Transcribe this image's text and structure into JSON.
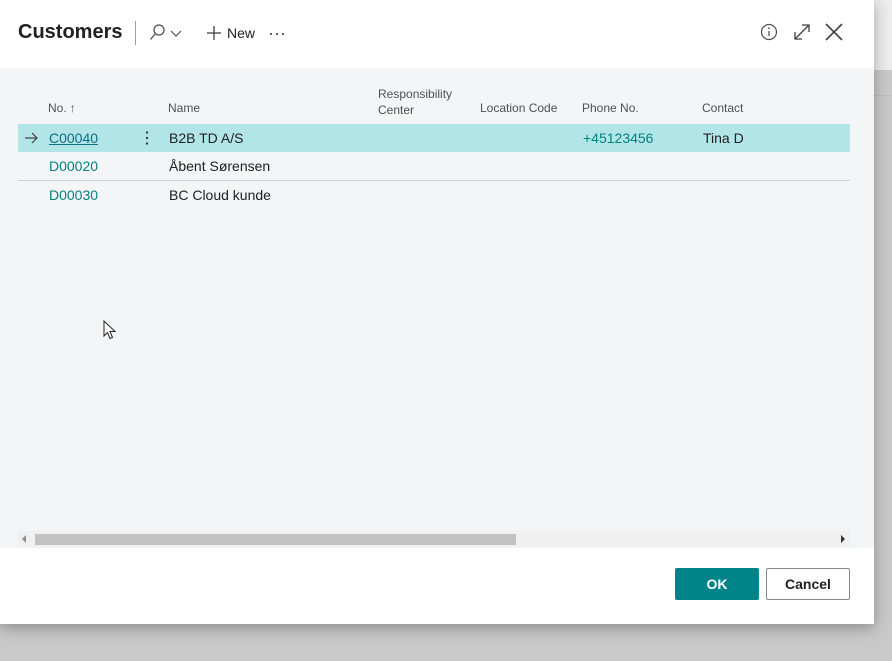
{
  "dialog": {
    "title": "Customers",
    "new_label": "New",
    "icons": [
      "search-icon",
      "chevron-down-icon",
      "plus-icon",
      "more-icon",
      "info-icon",
      "expand-icon",
      "close-icon"
    ]
  },
  "table": {
    "columns": {
      "no": "No.",
      "name": "Name",
      "responsibility_center_1": "Responsibility",
      "responsibility_center_2": "Center",
      "location_code": "Location Code",
      "phone_no": "Phone No.",
      "contact": "Contact"
    },
    "rows": [
      {
        "no": "C00040",
        "name": "B2B TD A/S",
        "responsibility_center": "",
        "location_code": "",
        "phone_no": "+45123456",
        "contact": "Tina D",
        "selected": true
      },
      {
        "no": "D00020",
        "name": "Åbent Sørensen",
        "responsibility_center": "",
        "location_code": "",
        "phone_no": "",
        "contact": "",
        "selected": false
      },
      {
        "no": "D00030",
        "name": "BC Cloud kunde",
        "responsibility_center": "",
        "location_code": "",
        "phone_no": "",
        "contact": "",
        "selected": false
      }
    ]
  },
  "footer": {
    "ok_label": "OK",
    "cancel_label": "Cancel"
  },
  "colors": {
    "accent": "#008489",
    "selected_row": "#b2e5e7",
    "link": "#00827f"
  }
}
